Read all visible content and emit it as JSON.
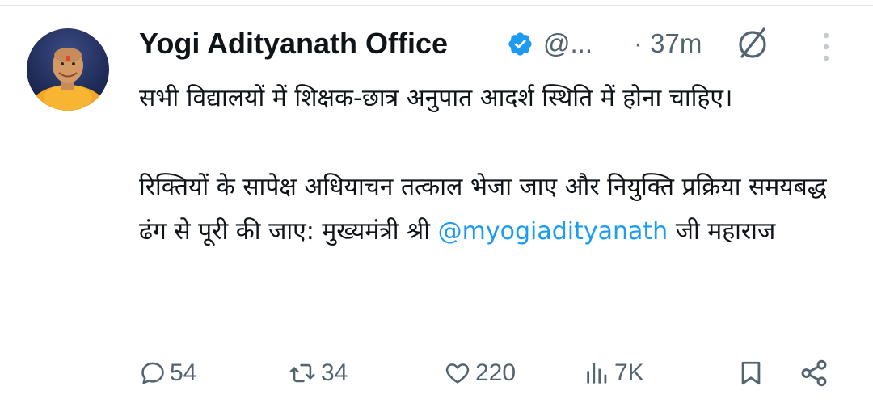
{
  "tweet": {
    "display_name": "Yogi Adityanath Office",
    "handle": "@...",
    "time": "· 37m",
    "verified": true,
    "paragraph1": "सभी विद्यालयों में शिक्षक-छात्र अनुपात आदर्श स्थिति में होना चाहिए।",
    "paragraph2": "रिक्तियों के सापेक्ष अधियाचन तत्काल भेजा जाए और नियुक्ति प्रक्रिया समयबद्ध ढंग से पूरी की जाए: मुख्यमंत्री श्री",
    "mention": "@myogiadityanath",
    "tail": " जी महाराज"
  },
  "actions": {
    "replies": "54",
    "reposts": "34",
    "likes": "220",
    "views": "7K"
  },
  "icons": {
    "verified": "verified-badge-icon",
    "grok": "grok-icon",
    "more": "more-vertical-icon",
    "reply": "reply-icon",
    "repost": "repost-icon",
    "like": "heart-icon",
    "views": "views-icon",
    "bookmark": "bookmark-icon",
    "share": "share-icon"
  },
  "colors": {
    "text": "#0f1419",
    "secondary": "#536471",
    "accent": "#1d9bf0"
  }
}
